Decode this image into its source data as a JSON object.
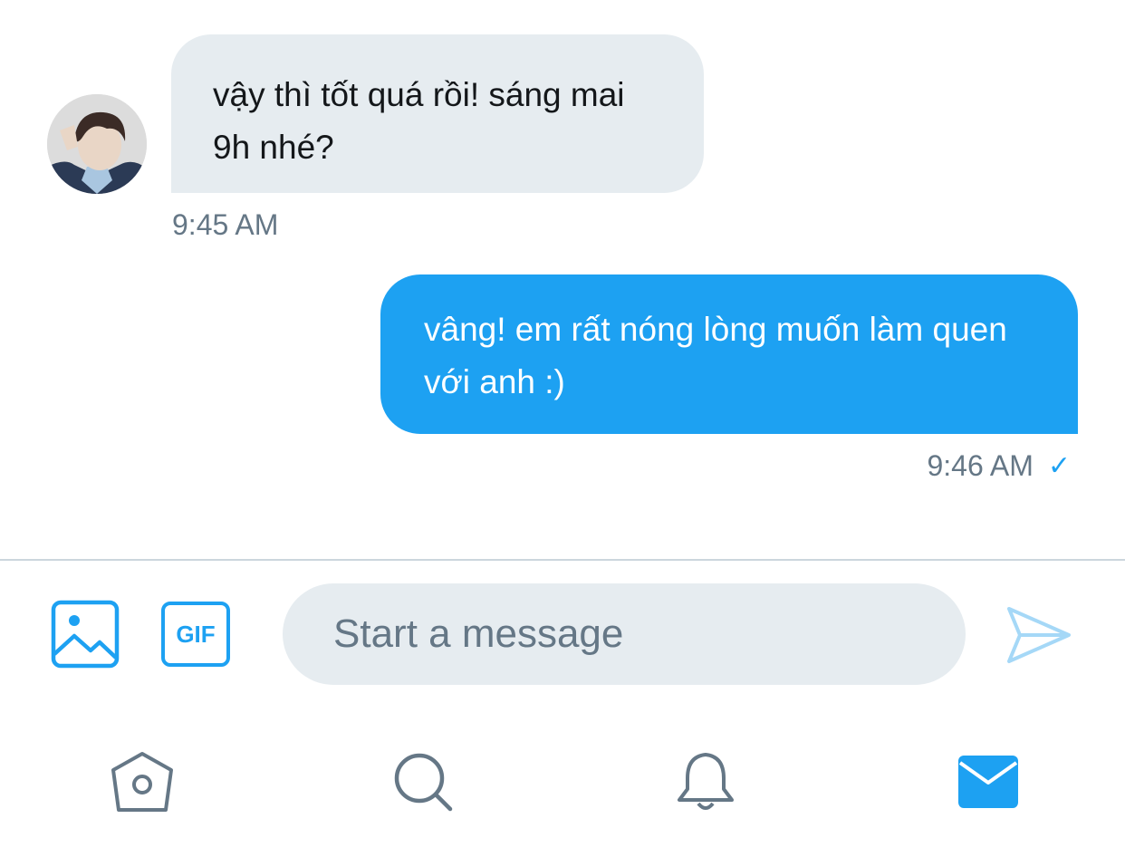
{
  "conversation": {
    "incoming": {
      "text": "vậy thì tốt quá rồi! sáng mai 9h nhé?",
      "time": "9:45 AM"
    },
    "outgoing": {
      "text": "vâng! em rất nóng lòng muốn làm quen với anh :)",
      "time": "9:46 AM",
      "status_glyph": "✓"
    }
  },
  "composer": {
    "placeholder": "Start a message",
    "gif_label": "GIF",
    "icons": [
      "image-icon",
      "gif-icon",
      "send-icon"
    ]
  },
  "bottom_nav": {
    "items": [
      "home-icon",
      "search-icon",
      "notifications-bell-icon",
      "messages-envelope-icon"
    ],
    "active": "messages-envelope-icon"
  },
  "colors": {
    "accent": "#1da1f2",
    "incoming_bubble": "#e6ecf0",
    "secondary_text": "#657786",
    "nav_icon": "#657786"
  }
}
